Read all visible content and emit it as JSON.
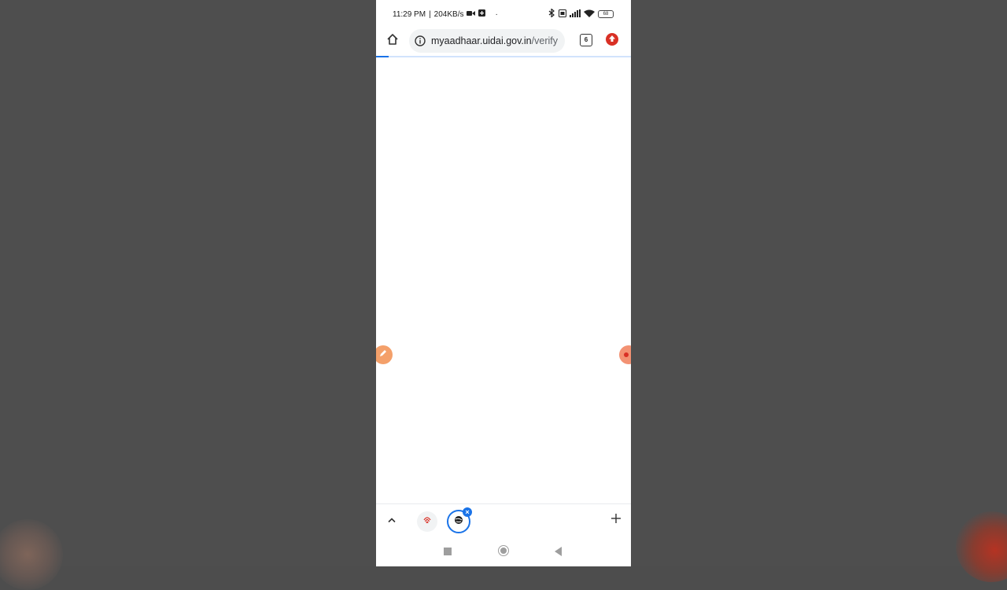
{
  "status_bar": {
    "time": "11:29 PM",
    "separator": "|",
    "network_speed": "204KB/s",
    "dot": "·",
    "battery": "68",
    "icons": [
      "video-icon",
      "notification-icon",
      "bluetooth-icon",
      "sim-icon",
      "signal-icon",
      "wifi-icon",
      "battery-icon"
    ]
  },
  "browser": {
    "url_host": "myaadhaar.uidai.gov.in",
    "url_path": "/verify",
    "tab_count": "6",
    "page_load_progress": 0.05
  },
  "colors": {
    "accent": "#1a73e8",
    "upload_red": "#d93025",
    "float_orange": "#f4a06a",
    "backdrop": "#4e4e4e"
  },
  "tab_strip": {
    "icons": [
      "chevron-up-icon",
      "fingerprint-favicon-icon",
      "globe-favicon-icon",
      "close-icon",
      "plus-icon"
    ]
  },
  "nav_bar": {
    "icons": [
      "recents-square-icon",
      "home-circle-icon",
      "back-triangle-icon"
    ]
  }
}
